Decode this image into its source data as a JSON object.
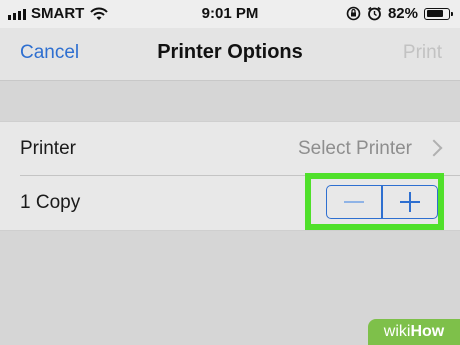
{
  "status_bar": {
    "carrier": "SMART",
    "time": "9:01 PM",
    "battery": "82%",
    "battery_level": 0.82
  },
  "nav": {
    "cancel": "Cancel",
    "title": "Printer Options",
    "print": "Print"
  },
  "rows": {
    "printer": {
      "label": "Printer",
      "value": "Select Printer"
    },
    "copies": {
      "label": "1 Copy"
    }
  },
  "icons": {
    "signal": "signal-bars-icon",
    "wifi": "wifi-icon",
    "orientation_lock": "orientation-lock-icon",
    "alarm": "alarm-icon",
    "battery": "battery-icon",
    "chevron": "chevron-right-icon",
    "minus": "minus-icon",
    "plus": "plus-icon"
  },
  "colors": {
    "accent": "#2e6fd0",
    "disabled": "#c2c2c2",
    "highlight": "#4fe02a",
    "watermark": "#7ec04a"
  },
  "watermark": {
    "part1": "wiki",
    "part2": "How"
  }
}
